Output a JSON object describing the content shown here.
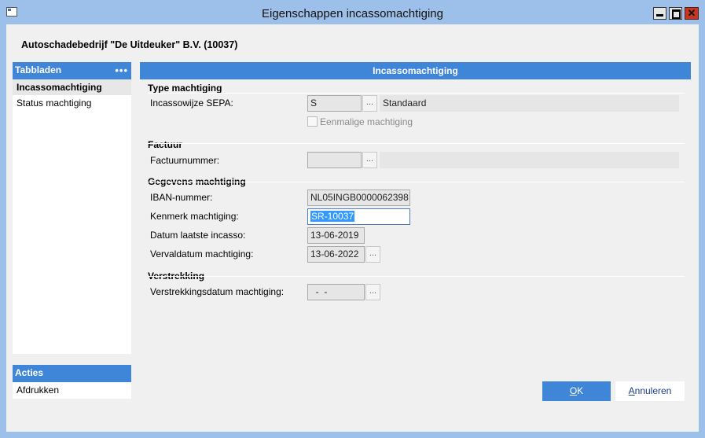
{
  "window": {
    "title": "Eigenschappen incassomachtiging"
  },
  "company": "Autoschadebedrijf \"De Uitdeuker\" B.V. (10037)",
  "sidebar": {
    "header": "Tabbladen",
    "more": "•••",
    "items": [
      {
        "label": "Incassomachtiging"
      },
      {
        "label": "Status machtiging"
      }
    ]
  },
  "acties": {
    "header": "Acties",
    "items": [
      {
        "label": "Afdrukken"
      }
    ]
  },
  "main": {
    "header": "Incassomachtiging",
    "sections": {
      "type": {
        "title": "Type machtiging",
        "incasso_label": "Incassowijze SEPA:",
        "incasso_code": "S",
        "incasso_desc": "Standaard",
        "eenmalig_label": "Eenmalige machtiging",
        "eenmalig_checked": false
      },
      "factuur": {
        "title": "Factuur",
        "nummer_label": "Factuurnummer:",
        "nummer_value": "",
        "nummer_desc": ""
      },
      "gegevens": {
        "title": "Gegevens machtiging",
        "iban_label": "IBAN-nummer:",
        "iban_value": "NL05INGB0000062398",
        "kenmerk_label": "Kenmerk machtiging:",
        "kenmerk_value": "SR-10037",
        "laatste_label": "Datum laatste incasso:",
        "laatste_value": "13-06-2019",
        "verval_label": "Vervaldatum machtiging:",
        "verval_value": "13-06-2022"
      },
      "verstrekking": {
        "title": "Verstrekking",
        "datum_label": "Verstrekkingsdatum machtiging:",
        "datum_value": "  -  -"
      }
    }
  },
  "buttons": {
    "ok_accel": "O",
    "ok_rest": "K",
    "cancel_accel": "A",
    "cancel_rest": "nnuleren"
  },
  "dots_glyph": "...",
  "colors": {
    "accent": "#3f86d9",
    "titlebar": "#9dc0ea",
    "close": "#c7371f"
  }
}
